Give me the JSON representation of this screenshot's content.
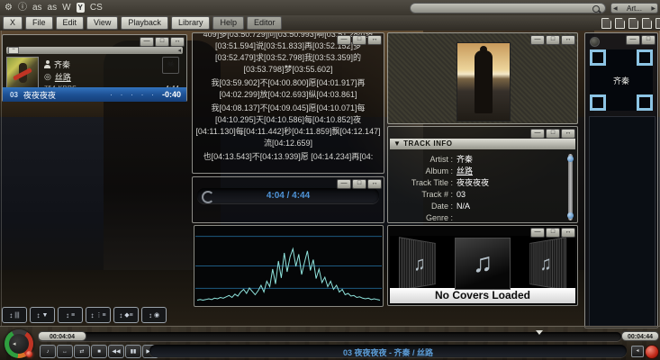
{
  "chrome": {
    "minimize": "—",
    "maximize": "□",
    "resize": "↔",
    "arrow_left": "◀",
    "arrow_right": "▶",
    "collapse": "−",
    "mini_arrow": "◂"
  },
  "topbar": {
    "icons": [
      {
        "name": "gear",
        "glyph": "⚙"
      },
      {
        "name": "info",
        "glyph": "ⓘ"
      },
      {
        "name": "lastfm",
        "glyph": "as"
      },
      {
        "name": "audioscrobbler",
        "glyph": "as"
      },
      {
        "name": "wikipedia",
        "glyph": "W"
      },
      {
        "name": "youtube",
        "glyph": "Y"
      },
      {
        "name": "cs",
        "glyph": "CS"
      }
    ]
  },
  "menu": {
    "items": [
      "X",
      "File",
      "Edit",
      "View",
      "Playback",
      "Library",
      "Help",
      "Editor"
    ]
  },
  "search": {
    "value": "",
    "selector": "Art..."
  },
  "player": {
    "artist": "齐秦",
    "album": "丝路",
    "bitrate": "754 KBPS",
    "duration": "4:44",
    "playlist_row": {
      "number": "03",
      "title": "夜夜夜夜",
      "dots": "· · · · ·",
      "remaining": "-0:40"
    },
    "skull_glyph": "☠"
  },
  "lyrics": {
    "lines": [
      "409]多[03:50.729]问[03:50.993]啊[03:51.284]多[03:51.594]说[03:51.833]再[03:52.152]多[03:52.479]求[03:52.798]我[03:53.359]的[03:53.798]梦[03:55.602]",
      "我[03:59.902]不[04:00.800]愿[04:01.917]再[04:02.299]放[04:02.693]纵[04:03.861]",
      "我[04:08.137]不[04:09.045]愿[04:10.071]每[04:10.295]天[04:10.586]每[04:10.852]夜[04:11.130]每[04:11.442]秒[04:11.859]飘[04:12.147]流[04:12.659]",
      "也[04:13.543]不[04:13.939]愿 [04:14.234]再[04:"
    ]
  },
  "time_display": "4:04 / 4:44",
  "spectrum": {
    "values": [
      2,
      3,
      2,
      3,
      4,
      3,
      5,
      4,
      6,
      5,
      7,
      9,
      6,
      11,
      8,
      14,
      18,
      12,
      20,
      15,
      10,
      16,
      24,
      14,
      30,
      22,
      48,
      26,
      60,
      35,
      72,
      44,
      66,
      78,
      52,
      70,
      40,
      58,
      75,
      46,
      62,
      34,
      48,
      28,
      36,
      22,
      30,
      18,
      24,
      14,
      18,
      10,
      12,
      8,
      9,
      6,
      7,
      5,
      4,
      5,
      3,
      4,
      3,
      2
    ],
    "gridlines": [
      0.13,
      0.5,
      0.78
    ],
    "line_color": "#8fe3dc",
    "grid_color": "#1d5a80"
  },
  "track_info": {
    "header": "TRACK INFO",
    "header_arrow": "▼",
    "rows": [
      {
        "label": "Artist :",
        "value": "齐秦"
      },
      {
        "label": "Album :",
        "value": "丝路"
      },
      {
        "label": "Track Title :",
        "value": "夜夜夜夜"
      },
      {
        "label": "Track # :",
        "value": "03"
      },
      {
        "label": "Date :",
        "value": "N/A"
      },
      {
        "label": "Genre :",
        "value": ""
      }
    ]
  },
  "covers": {
    "message": "No Covers Loaded",
    "note_glyph": "♫"
  },
  "sidebar": {
    "artist_label": "齐秦"
  },
  "toolbar": {
    "updown_glyph": "↕",
    "buttons": [
      {
        "name": "equalizer",
        "glyph": "|||"
      },
      {
        "name": "filter",
        "glyph": "▼"
      },
      {
        "name": "list",
        "glyph": "≡"
      },
      {
        "name": "queue",
        "glyph": "⋮≡"
      },
      {
        "name": "artist-list",
        "glyph": "◆≡"
      },
      {
        "name": "disc",
        "glyph": "◉"
      }
    ]
  },
  "transport": {
    "elapsed": "00:04:04",
    "total": "00:04:44",
    "now_playing": "03 夜夜夜夜 - 齐秦 / 丝路",
    "progress_pct": 86,
    "buttons": [
      {
        "name": "song",
        "glyph": "♪"
      },
      {
        "name": "crossfade",
        "glyph": "↔"
      },
      {
        "name": "shuffle",
        "glyph": "⇄"
      },
      {
        "name": "stop",
        "glyph": "■"
      },
      {
        "name": "previous",
        "glyph": "◀◀"
      },
      {
        "name": "pause",
        "glyph": "▮▮"
      },
      {
        "name": "next",
        "glyph": "▶▶"
      }
    ]
  }
}
